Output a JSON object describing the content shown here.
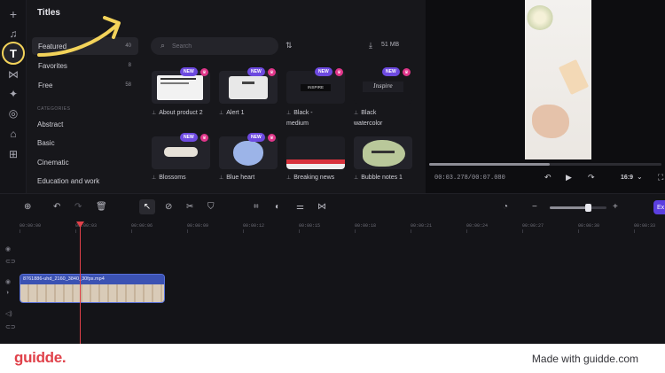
{
  "sidebar": {
    "icons": [
      "plus-icon",
      "music-icon",
      "text-icon",
      "transition-icon",
      "effects-icon",
      "filters-icon",
      "stickers-icon",
      "apps-icon"
    ],
    "active": "text-icon"
  },
  "titles_panel": {
    "title": "Titles",
    "categories": [
      {
        "label": "Featured",
        "count": "40"
      },
      {
        "label": "Favorites",
        "count": "8"
      },
      {
        "label": "Free",
        "count": "58"
      }
    ],
    "section_label": "CATEGORIES",
    "links": [
      "Abstract",
      "Basic",
      "Cinematic",
      "Education and work"
    ]
  },
  "content": {
    "search_placeholder": "Search",
    "upload_label": "51 MB",
    "new_badge": "NEW",
    "cards": [
      {
        "label": "About product 2",
        "new": true
      },
      {
        "label": "Alert 1",
        "new": true
      },
      {
        "label": "Black - medium",
        "new": true
      },
      {
        "label": "Black watercolor",
        "new": true
      },
      {
        "label": "Blossoms",
        "new": true
      },
      {
        "label": "Blue heart",
        "new": true
      },
      {
        "label": "Breaking news",
        "new": false
      },
      {
        "label": "Bubble notes 1",
        "new": false
      }
    ],
    "card_art_text": [
      "INSPIRE",
      "Inspire"
    ]
  },
  "preview": {
    "timecode": "00:03.278/00:07.080",
    "aspect": "16:9",
    "progress": 0.52
  },
  "timeline": {
    "export_label": "Ex",
    "zoom": 0.67,
    "ticks": [
      "00:00:00",
      "00:00:03",
      "00:00:06",
      "00:00:09",
      "00:00:12",
      "00:00:15",
      "00:00:18",
      "00:00:21",
      "00:00:24",
      "00:00:27",
      "00:00:30",
      "00:00:33"
    ],
    "clip_name": "8761886-uhd_2160_3840_30fps.mp4"
  },
  "footer": {
    "brand": "guidde.",
    "tagline": "Made with guidde.com"
  },
  "colors": {
    "accent": "#5b3fe0",
    "brand": "#e0414a",
    "annotation": "#f3d35a",
    "new_badge": "#6d4ae0"
  }
}
